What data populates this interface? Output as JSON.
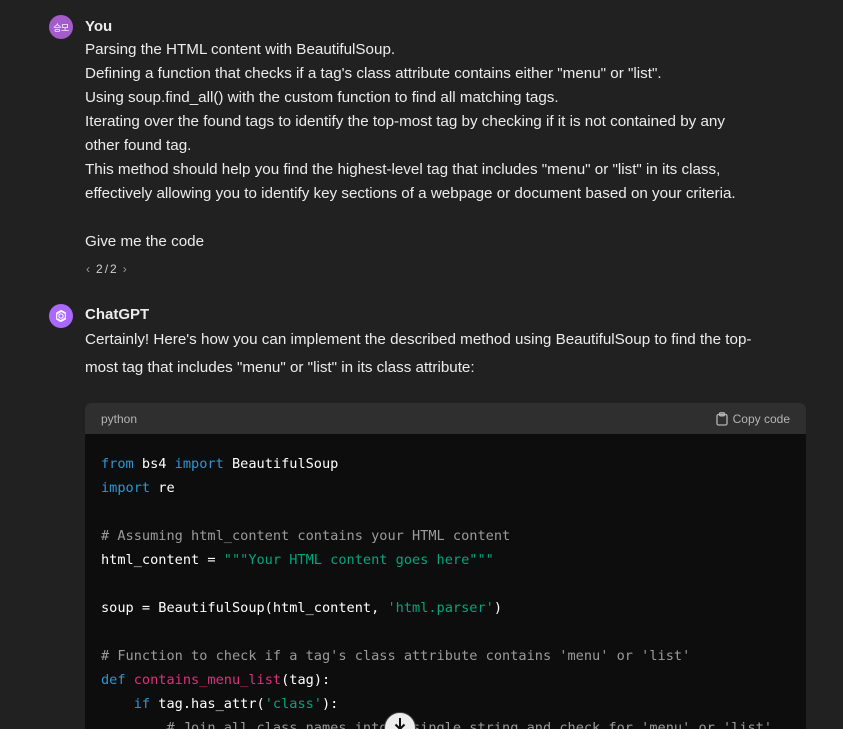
{
  "user_message": {
    "avatar_text": "승모",
    "author": "You",
    "lines": [
      "Parsing the HTML content with BeautifulSoup.",
      "Defining a function that checks if a tag's class attribute contains either \"menu\" or \"list\".",
      "Using soup.find_all() with the custom function to find all matching tags.",
      "Iterating over the found tags to identify the top-most tag by checking if it is not contained by any",
      "other found tag.",
      "This method should help you find the highest-level tag that includes \"menu\" or \"list\" in its class,",
      "effectively allowing you to identify key sections of a webpage or document based on your criteria.",
      "Give me the code"
    ],
    "pager": {
      "current": "2",
      "total": "2",
      "separator": "/"
    }
  },
  "assistant_message": {
    "author": "ChatGPT",
    "avatar_icon": "openai-logo-icon",
    "lines": [
      "Certainly! Here's how you can implement the described method using BeautifulSoup to find the top-",
      "most tag that includes \"menu\" or \"list\" in its class attribute:"
    ],
    "code_block": {
      "language": "python",
      "copy_label": "Copy code",
      "code": {
        "l1_kw": "from",
        "l1_mod": " bs4 ",
        "l1_kw2": "import",
        "l1_rest": " BeautifulSoup",
        "l2_kw": "import",
        "l2_rest": " re",
        "l4_comment": "# Assuming html_content contains your HTML content",
        "l5_a": "html_content = ",
        "l5_str": "\"\"\"Your HTML content goes here\"\"\"",
        "l7_a": "soup = BeautifulSoup(html_content, ",
        "l7_str": "'html.parser'",
        "l7_b": ")",
        "l9_comment": "# Function to check if a tag's class attribute contains 'menu' or 'list'",
        "l10_kw": "def",
        "l10_fn": "contains_menu_list",
        "l10_rest": "(tag):",
        "l11_kw": "if",
        "l11_a": " tag.has_attr(",
        "l11_str": "'class'",
        "l11_b": "):",
        "l12_comment": "# Join all class names into a single string and check for 'menu' or 'list'"
      }
    }
  },
  "colors": {
    "background": "#212121",
    "code_background": "#0d0d0d",
    "code_header": "#2f2f2f",
    "keyword": "#2e95d3",
    "string": "#00a67d",
    "function_name": "#df3079",
    "comment": "#9b9b9b",
    "user_avatar": "#a35cc9",
    "assistant_avatar": "#ab68ff"
  }
}
